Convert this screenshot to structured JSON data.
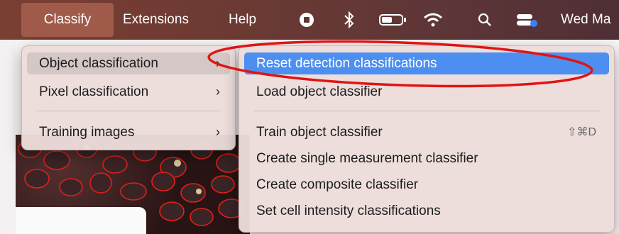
{
  "menubar": {
    "classify": "Classify",
    "extensions": "Extensions",
    "help": "Help",
    "clock": "Wed Ma"
  },
  "main_menu": {
    "items": [
      {
        "label": "Object classification",
        "arrow": "›"
      },
      {
        "label": "Pixel classification",
        "arrow": "›"
      },
      {
        "label": "Training images",
        "arrow": "›"
      }
    ]
  },
  "sub_menu": {
    "items": [
      {
        "label": "Reset detection classifications",
        "shortcut": ""
      },
      {
        "label": "Load object classifier",
        "shortcut": ""
      },
      {
        "label": "Train object classifier",
        "shortcut": "⇧⌘D"
      },
      {
        "label": "Create single measurement classifier",
        "shortcut": ""
      },
      {
        "label": "Create composite classifier",
        "shortcut": ""
      },
      {
        "label": "Set cell intensity classifications",
        "shortcut": ""
      }
    ]
  },
  "annotation_color": "#e01414",
  "highlight_color": "#4d8ff0"
}
